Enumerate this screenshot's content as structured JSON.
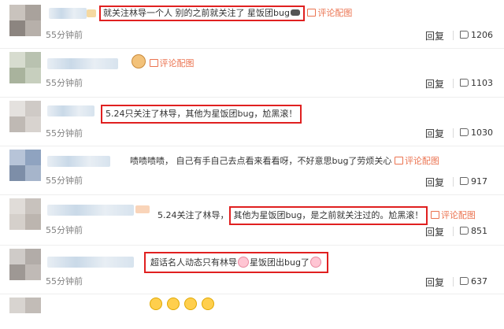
{
  "labels": {
    "reply": "回复",
    "pic": "评论配图"
  },
  "comments": [
    {
      "text": "就关注林导一个人 别的之前就关注了 星饭团bug",
      "time": "55分钟前",
      "likes": "1206"
    },
    {
      "text": "",
      "time": "55分钟前",
      "likes": "1103"
    },
    {
      "text": "5.24只关注了林导，其他为星饭团bug，尬黑滚！",
      "time": "55分钟前",
      "likes": "1030"
    },
    {
      "text": "啧啧啧啧， 自己有手自己去点看来看看呀，不好意思bug了劳烦关心",
      "time": "55分钟前",
      "likes": "917"
    },
    {
      "text_pre": "5.24关注了林导，",
      "text_box": "其他为星饭团bug，是之前就关注过的。尬黑滚！",
      "time": "55分钟前",
      "likes": "851"
    },
    {
      "text_a": "超话名人动态只有林导",
      "text_b": "星饭团出bug了",
      "time": "55分钟前",
      "likes": "637"
    }
  ],
  "colors": {
    "highlight_border": "#e02020",
    "link": "#eb7350",
    "time": "#808080"
  },
  "icons": [
    "thumbs-up-icon",
    "image-icon",
    "pig-emoji",
    "cat-emoji",
    "smile-emoji"
  ]
}
